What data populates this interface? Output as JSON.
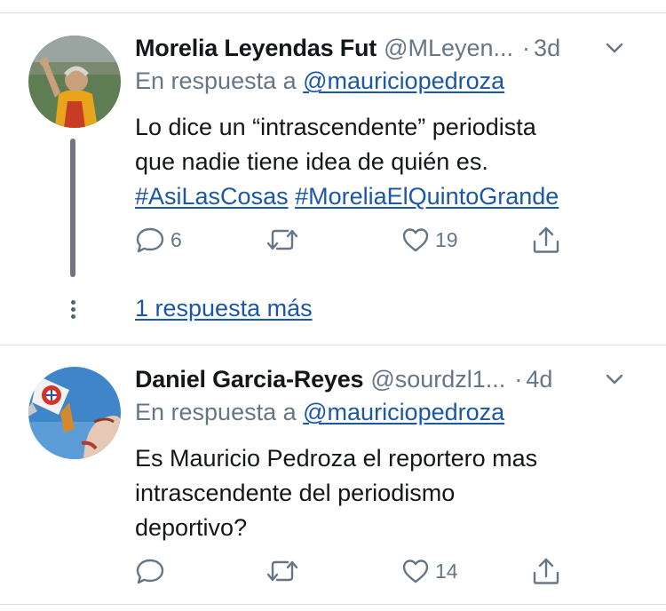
{
  "tweets": [
    {
      "author_name": "Morelia Leyendas Fut",
      "handle": "@MLeyen...",
      "separator": "·",
      "time": "3d",
      "reply_prefix": "En respuesta a",
      "reply_mention": "@mauriciopedroza",
      "text_lines": [
        "Lo dice un “intrascendente” periodista",
        "que nadie tiene idea de quién es."
      ],
      "hashtags": [
        "#AsiLasCosas",
        "#MoreliaElQuintoGrande"
      ],
      "reply_count": "6",
      "retweet_count": "",
      "like_count": "19",
      "more_replies": "1 respuesta más"
    },
    {
      "author_name": "Daniel Garcia-Reyes",
      "handle": "@sourdzl1...",
      "separator": "·",
      "time": "4d",
      "reply_prefix": "En respuesta a",
      "reply_mention": "@mauriciopedroza",
      "text_lines": [
        "Es Mauricio Pedroza el reportero mas",
        "intrascendente del periodismo",
        "deportivo?"
      ],
      "reply_count": "",
      "retweet_count": "",
      "like_count": "14"
    }
  ],
  "icons": {
    "reply": "reply-icon",
    "retweet": "retweet-icon",
    "like": "heart-icon",
    "share": "share-icon",
    "menu": "chevron-down-icon"
  },
  "colors": {
    "link": "#1b57a8",
    "secondary_text": "#657786",
    "divider": "#d8dde2"
  }
}
